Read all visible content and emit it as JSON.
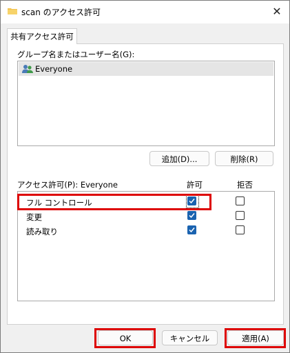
{
  "window": {
    "title": "scan のアクセス許可",
    "close_glyph": "✕"
  },
  "tabs": [
    {
      "label": "共有アクセス許可"
    }
  ],
  "group_section": {
    "label": "グループ名またはユーザー名(G):",
    "items": [
      {
        "name": "Everyone",
        "icon": "users-icon",
        "selected": true
      }
    ]
  },
  "buttons": {
    "add": "追加(D)...",
    "remove": "削除(R)",
    "ok": "OK",
    "cancel": "キャンセル",
    "apply": "適用(A)"
  },
  "permissions": {
    "label": "アクセス許可(P): Everyone",
    "allow_header": "許可",
    "deny_header": "拒否",
    "rows": [
      {
        "name": "フル コントロール",
        "allow": true,
        "deny": false
      },
      {
        "name": "変更",
        "allow": true,
        "deny": false
      },
      {
        "name": "読み取り",
        "allow": true,
        "deny": false
      }
    ]
  },
  "colors": {
    "checkbox_checked": "#1a63b0",
    "highlight": "#dd0000"
  }
}
